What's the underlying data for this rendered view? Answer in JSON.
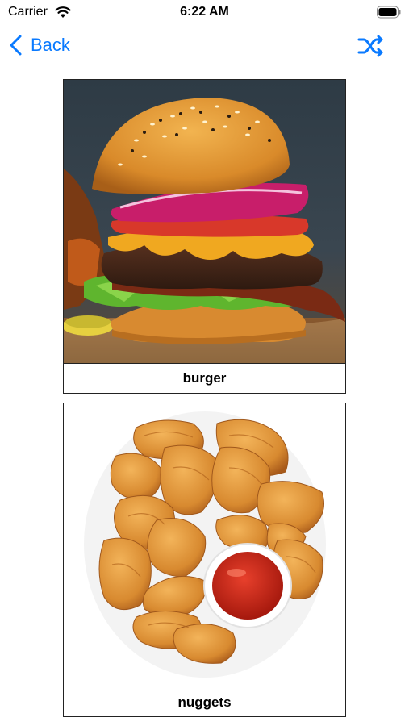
{
  "status_bar": {
    "carrier": "Carrier",
    "time": "6:22 AM"
  },
  "nav": {
    "back_label": "Back",
    "shuffle_icon": "shuffle-icon"
  },
  "colors": {
    "accent": "#0a7aff"
  },
  "cards": [
    {
      "caption": "burger",
      "image": "burger-photo"
    },
    {
      "caption": "nuggets",
      "image": "nuggets-photo"
    }
  ]
}
